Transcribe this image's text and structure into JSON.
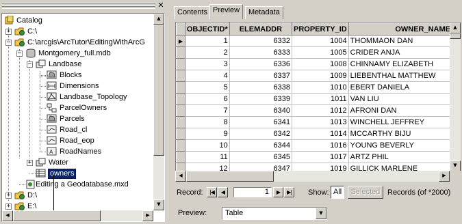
{
  "catalog_tree": {
    "root": "Catalog",
    "items": [
      {
        "label": "C:\\"
      },
      {
        "label": "C:\\arcgis\\ArcTutor\\EditingWithArcG"
      },
      {
        "label": "Montgomery_full.mdb"
      },
      {
        "label": "Landbase"
      },
      {
        "label": "Blocks"
      },
      {
        "label": "Dimensions"
      },
      {
        "label": "Landbase_Topology"
      },
      {
        "label": "ParcelOwners"
      },
      {
        "label": "Parcels"
      },
      {
        "label": "Road_cl"
      },
      {
        "label": "Road_eop"
      },
      {
        "label": "RoadNames"
      },
      {
        "label": "Water"
      },
      {
        "label": "owners"
      },
      {
        "label": "Editing a Geodatabase.mxd"
      },
      {
        "label": "D:\\"
      },
      {
        "label": "E:\\"
      }
    ],
    "expand_plus": "+",
    "expand_minus": "−"
  },
  "tabs": [
    {
      "label": "Contents"
    },
    {
      "label": "Preview"
    },
    {
      "label": "Metadata"
    }
  ],
  "table": {
    "columns": [
      "OBJECTID*",
      "ELEMADDR",
      "PROPERTY_ID",
      "OWNER_NAME"
    ],
    "rows": [
      [
        "1",
        "6332",
        "1004",
        "THOMMAON DAN"
      ],
      [
        "2",
        "6333",
        "1005",
        "CRIDER ANJA"
      ],
      [
        "3",
        "6336",
        "1008",
        "CHINNAMY ELIZABETH"
      ],
      [
        "4",
        "6337",
        "1009",
        "LIEBENTHAL MATTHEW"
      ],
      [
        "5",
        "6338",
        "1010",
        "EBERT DANIELA"
      ],
      [
        "6",
        "6339",
        "1011",
        "VAN LIU"
      ],
      [
        "7",
        "6340",
        "1012",
        "AFRONI DAN"
      ],
      [
        "8",
        "6341",
        "1013",
        "WINCHELL JEFFREY"
      ],
      [
        "9",
        "6342",
        "1014",
        "MCCARTHY BIJU"
      ],
      [
        "10",
        "6344",
        "1016",
        "YOUNG BEVERLY"
      ],
      [
        "11",
        "6345",
        "1017",
        "ARTZ PHIL"
      ],
      [
        "12",
        "6347",
        "1019",
        "GILLICK MARLENE"
      ]
    ]
  },
  "record_bar": {
    "record_label": "Record:",
    "record_value": "1",
    "show_label": "Show:",
    "all_label": "All",
    "selected_label": "Selected",
    "records_label": "Records (of *2000)"
  },
  "preview_bar": {
    "label": "Preview:",
    "value": "Table"
  },
  "icons": {
    "first": "first-record-icon",
    "prev": "previous-record-icon",
    "next": "next-record-icon",
    "last": "last-record-icon"
  }
}
